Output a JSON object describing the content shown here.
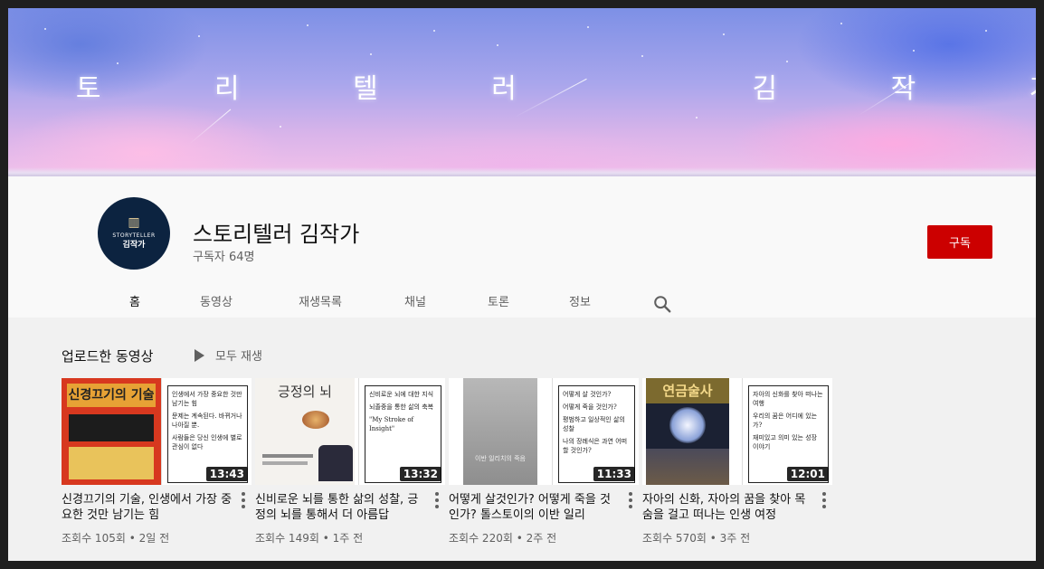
{
  "banner": {
    "title": "스 토 리 텔 러   김 작 가"
  },
  "channel": {
    "avatar_line1": "STORYTELLER",
    "avatar_line2": "김작가",
    "avatar_icon": "book-icon",
    "name": "스토리텔러 김작가",
    "subscribers": "구독자 64명",
    "subscribe_label": "구독"
  },
  "tabs": [
    {
      "label": "홈",
      "active": true
    },
    {
      "label": "동영상"
    },
    {
      "label": "재생목록"
    },
    {
      "label": "채널"
    },
    {
      "label": "토론"
    },
    {
      "label": "정보"
    }
  ],
  "section": {
    "title": "업로드한 동영상",
    "play_all": "모두 재생"
  },
  "videos": [
    {
      "title": "신경끄기의 기술, 인생에서 가장 중요한 것만 남기는 힘",
      "meta": "조회수 105회 • 2일 전",
      "duration": "13:43",
      "cover_title": "신경끄기의 기술",
      "points": [
        "인생에서 가장 중요한 것만 남기는 힘",
        "문제는 계속된다. 바뀌거나 나아질 뿐.",
        "사람들은 당신 인생에 별로 관심이 없다"
      ]
    },
    {
      "title": "신비로운 뇌를 통한 삶의 성찰, 긍정의 뇌를 통해서 더 아름답",
      "meta": "조회수 149회 • 1주 전",
      "duration": "13:32",
      "cover_title": "긍정의 뇌",
      "points": [
        "신비로운 뇌에 대한 지식",
        "뇌졸중을 통한 삶의 축복",
        "\"My Stroke of Insight\""
      ]
    },
    {
      "title": "어떻게 살것인가? 어떻게 죽을 것인가? 톨스토이의 이반 일리",
      "meta": "조회수 220회 • 2주 전",
      "duration": "11:33",
      "cover_title": "이반 일리치의 죽음",
      "points": [
        "어떻게 살 것인가?",
        "어떻게 죽을 것인가?",
        "평범하고 일상적인 삶의 성찰",
        "나의 장례식은 과연 어떠할 것인가?"
      ]
    },
    {
      "title": "자아의 신화, 자아의 꿈을 찾아 목숨을 걸고 떠나는 인생 여정",
      "meta": "조회수 570회 • 3주 전",
      "duration": "12:01",
      "cover_title": "연금술사",
      "points": [
        "자아의 신화를 찾아 떠나는 여행",
        "우리의 꿈은 어디에 있는가?",
        "재미있고 의미 있는 성장 이야기"
      ]
    }
  ],
  "colors": {
    "subscribe": "#cc0000",
    "avatar_bg": "#0c2340"
  }
}
